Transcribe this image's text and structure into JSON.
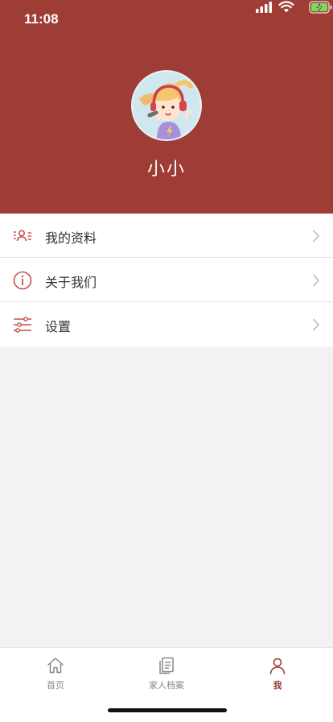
{
  "status_bar": {
    "time": "11:08",
    "icons": [
      "signal-icon",
      "wifi-icon",
      "battery-charging-icon"
    ]
  },
  "profile": {
    "avatar": "avatar-illustration",
    "name": "小小"
  },
  "menu": {
    "items": [
      {
        "label": "我的资料",
        "icon": "profile-card-icon"
      },
      {
        "label": "关于我们",
        "icon": "info-icon"
      },
      {
        "label": "设置",
        "icon": "sliders-icon"
      }
    ]
  },
  "tabbar": {
    "items": [
      {
        "label": "首页",
        "icon": "home-icon"
      },
      {
        "label": "家人档案",
        "icon": "documents-icon"
      },
      {
        "label": "我",
        "icon": "person-icon"
      }
    ],
    "active_index": 2
  },
  "colors": {
    "header_background": "#9e3d36",
    "accent": "#9e3d36",
    "page_background": "#f2f2f2"
  }
}
